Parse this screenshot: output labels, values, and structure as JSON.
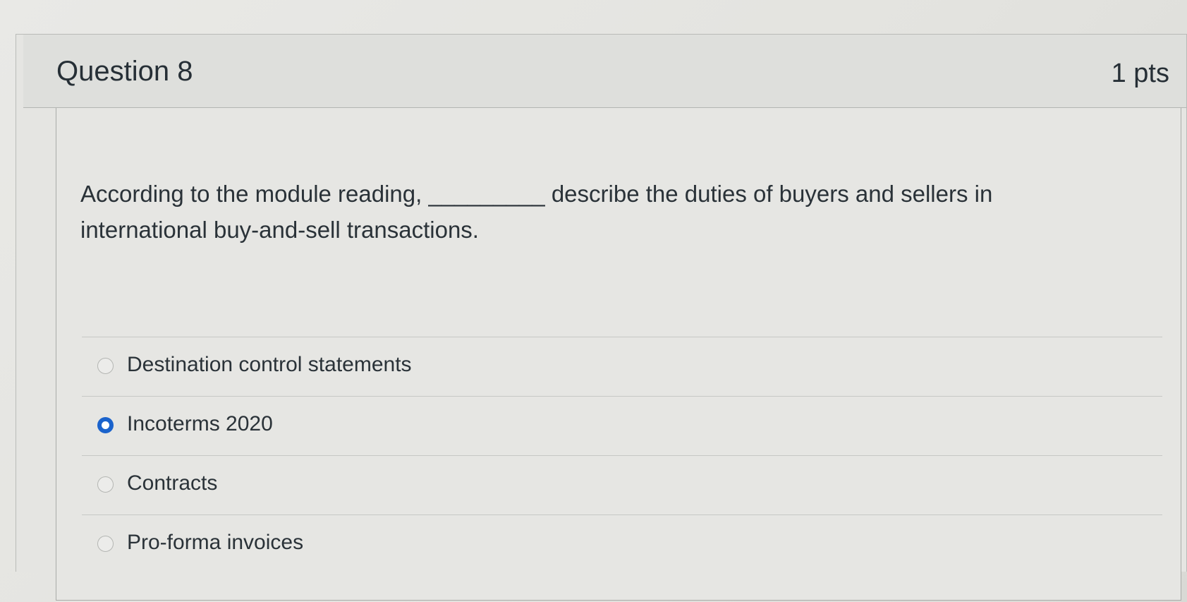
{
  "question": {
    "title": "Question 8",
    "points": "1 pts",
    "text": "According to the module reading, _________ describe the duties of buyers and sellers in international buy-and-sell transactions."
  },
  "answers": [
    {
      "label": "Destination control statements",
      "selected": false
    },
    {
      "label": "Incoterms 2020",
      "selected": true
    },
    {
      "label": "Contracts",
      "selected": false
    },
    {
      "label": "Pro-forma invoices",
      "selected": false
    }
  ],
  "colors": {
    "accent": "#1b63cc",
    "text": "#2a3238"
  }
}
